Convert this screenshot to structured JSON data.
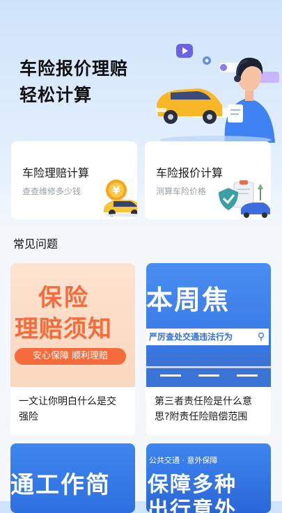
{
  "hero": {
    "title_line1": "车险报价理赔",
    "title_line2": "轻松计算"
  },
  "cards": [
    {
      "title": "车险理赔计算",
      "subtitle": "查查维修多少钱",
      "icon": "yen-coin-car-icon"
    },
    {
      "title": "车险报价计算",
      "subtitle": "测算车险价格",
      "icon": "shield-clipboard-car-icon"
    }
  ],
  "faq": {
    "section_title": "常见问题",
    "articles": [
      {
        "banner_line1": "保险",
        "banner_line2": "理赔须知",
        "banner_tag": "安心保障 顺利理赔",
        "title": "一文让你明白什么是交强险"
      },
      {
        "banner_line1": "本周焦",
        "banner_line2": "严厉查处交通违法行为",
        "title": "第三者责任险是什么意思?附责任险赔偿范围"
      },
      {
        "banner_line1": "通工作简"
      },
      {
        "banner_top": "公共交通 · 意外保障",
        "banner_line1": "保障多种",
        "banner_line2": "出行意外"
      }
    ]
  },
  "colors": {
    "accent_blue": "#2f6fe0",
    "banner_orange": "#f56b3c"
  }
}
